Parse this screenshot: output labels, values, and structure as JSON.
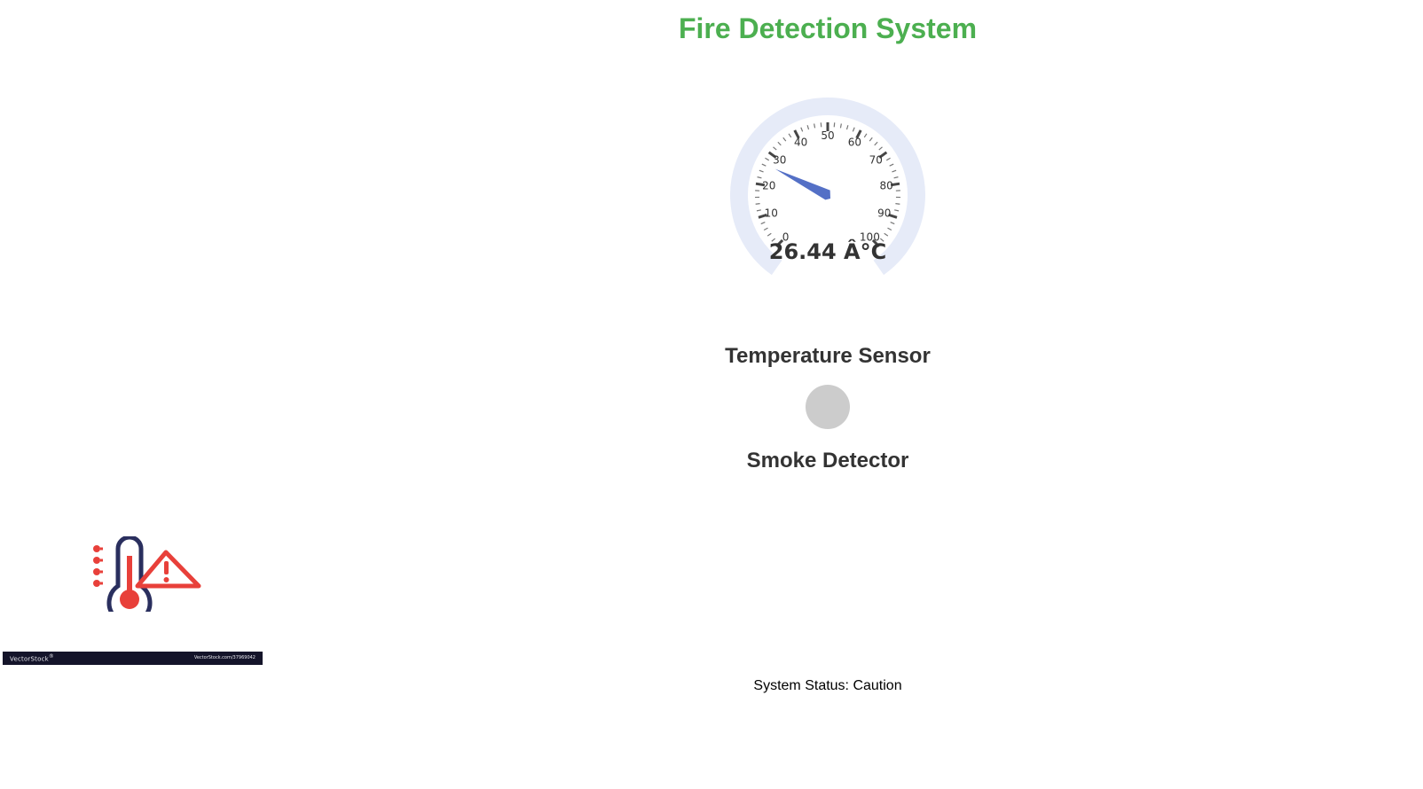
{
  "header": {
    "title": "Fire Detection System",
    "title_color": "#4caf50"
  },
  "temperature_gauge": {
    "value": 26.44,
    "value_text": "26.44 Â°C",
    "min": 0,
    "max": 100,
    "major_tick_labels": [
      "0",
      "10",
      "20",
      "30",
      "40",
      "50",
      "60",
      "70",
      "80",
      "90",
      "100"
    ],
    "needle_color": "#5470c6",
    "band_color": "#e6ebf8"
  },
  "sensors": {
    "temperature_label": "Temperature Sensor",
    "smoke_label": "Smoke Detector",
    "smoke_indicator_color": "#cccccc"
  },
  "status": {
    "text": "System Status: Caution"
  },
  "stock_image": {
    "icon": "thermometer-warning-icon",
    "brand": "VectorStock",
    "brand_mark": "®",
    "url": "VectorStock.com/37969042"
  }
}
